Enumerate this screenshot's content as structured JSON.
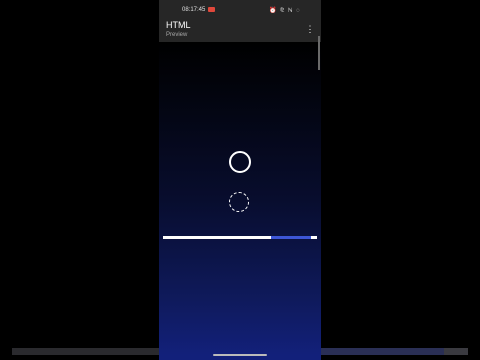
{
  "status_bar": {
    "time": "08:17:45",
    "icons": "⏰ ⅊ ℕ ◌"
  },
  "app_bar": {
    "title": "HTML",
    "subtitle": "Preview",
    "menu_icon": "more-vert-icon"
  },
  "preview": {
    "progress_fraction": 0.7,
    "colors": {
      "track": "#ffffff",
      "accent": "#3d56d6",
      "background_top": "#000000",
      "background_bottom": "#12207a"
    }
  }
}
